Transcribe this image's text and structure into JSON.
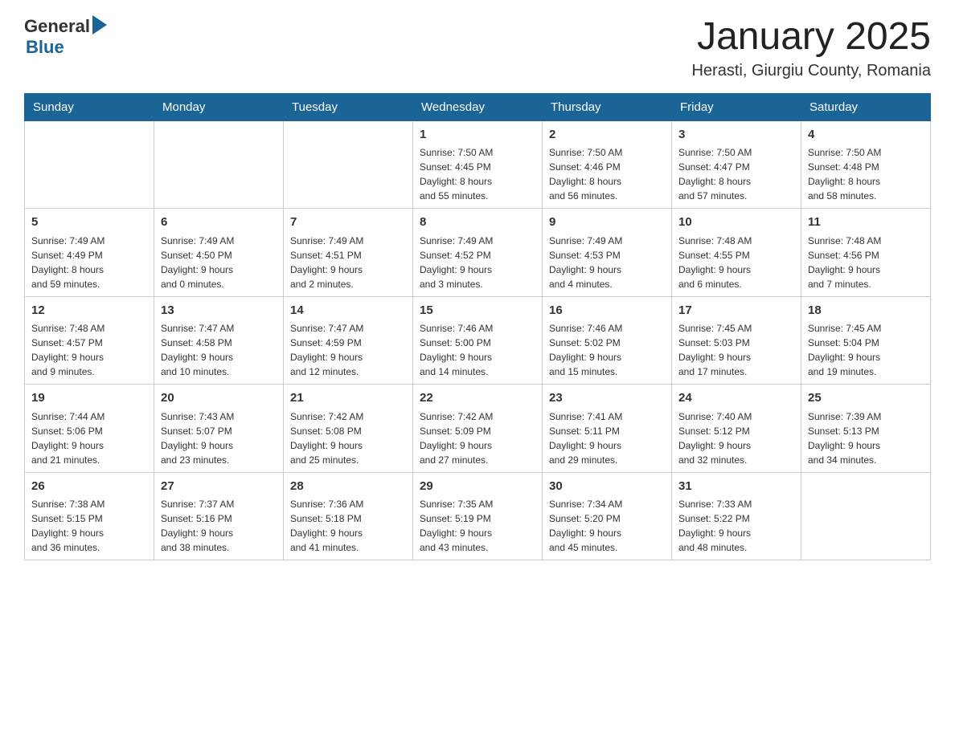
{
  "header": {
    "logo_general": "General",
    "logo_blue": "Blue",
    "title": "January 2025",
    "subtitle": "Herasti, Giurgiu County, Romania"
  },
  "calendar": {
    "days_of_week": [
      "Sunday",
      "Monday",
      "Tuesday",
      "Wednesday",
      "Thursday",
      "Friday",
      "Saturday"
    ],
    "weeks": [
      [
        {
          "day": "",
          "info": ""
        },
        {
          "day": "",
          "info": ""
        },
        {
          "day": "",
          "info": ""
        },
        {
          "day": "1",
          "info": "Sunrise: 7:50 AM\nSunset: 4:45 PM\nDaylight: 8 hours\nand 55 minutes."
        },
        {
          "day": "2",
          "info": "Sunrise: 7:50 AM\nSunset: 4:46 PM\nDaylight: 8 hours\nand 56 minutes."
        },
        {
          "day": "3",
          "info": "Sunrise: 7:50 AM\nSunset: 4:47 PM\nDaylight: 8 hours\nand 57 minutes."
        },
        {
          "day": "4",
          "info": "Sunrise: 7:50 AM\nSunset: 4:48 PM\nDaylight: 8 hours\nand 58 minutes."
        }
      ],
      [
        {
          "day": "5",
          "info": "Sunrise: 7:49 AM\nSunset: 4:49 PM\nDaylight: 8 hours\nand 59 minutes."
        },
        {
          "day": "6",
          "info": "Sunrise: 7:49 AM\nSunset: 4:50 PM\nDaylight: 9 hours\nand 0 minutes."
        },
        {
          "day": "7",
          "info": "Sunrise: 7:49 AM\nSunset: 4:51 PM\nDaylight: 9 hours\nand 2 minutes."
        },
        {
          "day": "8",
          "info": "Sunrise: 7:49 AM\nSunset: 4:52 PM\nDaylight: 9 hours\nand 3 minutes."
        },
        {
          "day": "9",
          "info": "Sunrise: 7:49 AM\nSunset: 4:53 PM\nDaylight: 9 hours\nand 4 minutes."
        },
        {
          "day": "10",
          "info": "Sunrise: 7:48 AM\nSunset: 4:55 PM\nDaylight: 9 hours\nand 6 minutes."
        },
        {
          "day": "11",
          "info": "Sunrise: 7:48 AM\nSunset: 4:56 PM\nDaylight: 9 hours\nand 7 minutes."
        }
      ],
      [
        {
          "day": "12",
          "info": "Sunrise: 7:48 AM\nSunset: 4:57 PM\nDaylight: 9 hours\nand 9 minutes."
        },
        {
          "day": "13",
          "info": "Sunrise: 7:47 AM\nSunset: 4:58 PM\nDaylight: 9 hours\nand 10 minutes."
        },
        {
          "day": "14",
          "info": "Sunrise: 7:47 AM\nSunset: 4:59 PM\nDaylight: 9 hours\nand 12 minutes."
        },
        {
          "day": "15",
          "info": "Sunrise: 7:46 AM\nSunset: 5:00 PM\nDaylight: 9 hours\nand 14 minutes."
        },
        {
          "day": "16",
          "info": "Sunrise: 7:46 AM\nSunset: 5:02 PM\nDaylight: 9 hours\nand 15 minutes."
        },
        {
          "day": "17",
          "info": "Sunrise: 7:45 AM\nSunset: 5:03 PM\nDaylight: 9 hours\nand 17 minutes."
        },
        {
          "day": "18",
          "info": "Sunrise: 7:45 AM\nSunset: 5:04 PM\nDaylight: 9 hours\nand 19 minutes."
        }
      ],
      [
        {
          "day": "19",
          "info": "Sunrise: 7:44 AM\nSunset: 5:06 PM\nDaylight: 9 hours\nand 21 minutes."
        },
        {
          "day": "20",
          "info": "Sunrise: 7:43 AM\nSunset: 5:07 PM\nDaylight: 9 hours\nand 23 minutes."
        },
        {
          "day": "21",
          "info": "Sunrise: 7:42 AM\nSunset: 5:08 PM\nDaylight: 9 hours\nand 25 minutes."
        },
        {
          "day": "22",
          "info": "Sunrise: 7:42 AM\nSunset: 5:09 PM\nDaylight: 9 hours\nand 27 minutes."
        },
        {
          "day": "23",
          "info": "Sunrise: 7:41 AM\nSunset: 5:11 PM\nDaylight: 9 hours\nand 29 minutes."
        },
        {
          "day": "24",
          "info": "Sunrise: 7:40 AM\nSunset: 5:12 PM\nDaylight: 9 hours\nand 32 minutes."
        },
        {
          "day": "25",
          "info": "Sunrise: 7:39 AM\nSunset: 5:13 PM\nDaylight: 9 hours\nand 34 minutes."
        }
      ],
      [
        {
          "day": "26",
          "info": "Sunrise: 7:38 AM\nSunset: 5:15 PM\nDaylight: 9 hours\nand 36 minutes."
        },
        {
          "day": "27",
          "info": "Sunrise: 7:37 AM\nSunset: 5:16 PM\nDaylight: 9 hours\nand 38 minutes."
        },
        {
          "day": "28",
          "info": "Sunrise: 7:36 AM\nSunset: 5:18 PM\nDaylight: 9 hours\nand 41 minutes."
        },
        {
          "day": "29",
          "info": "Sunrise: 7:35 AM\nSunset: 5:19 PM\nDaylight: 9 hours\nand 43 minutes."
        },
        {
          "day": "30",
          "info": "Sunrise: 7:34 AM\nSunset: 5:20 PM\nDaylight: 9 hours\nand 45 minutes."
        },
        {
          "day": "31",
          "info": "Sunrise: 7:33 AM\nSunset: 5:22 PM\nDaylight: 9 hours\nand 48 minutes."
        },
        {
          "day": "",
          "info": ""
        }
      ]
    ]
  }
}
